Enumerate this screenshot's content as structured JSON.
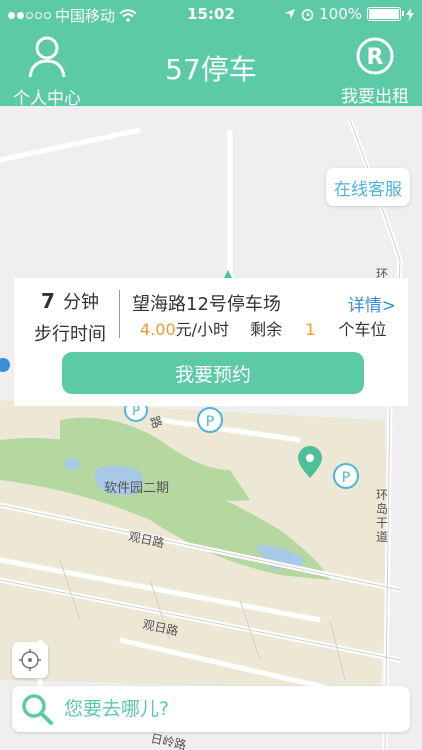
{
  "status_bar": {
    "carrier": "中国移动",
    "time": "15:02",
    "battery": "100%"
  },
  "header": {
    "title": "57停车",
    "left_label": "个人中心",
    "right_label": "我要出租"
  },
  "map": {
    "online_service": "在线客服",
    "labels": {
      "park": "软件园二期",
      "road1": "观日路",
      "road2": "观日路",
      "road3": "环岛干道",
      "road4": "路",
      "road5": "环",
      "road6": "日岭路"
    }
  },
  "card": {
    "walk_minutes": "7",
    "walk_unit": "分钟",
    "walk_label": "步行时间",
    "lot_name": "望海路12号停车场",
    "detail": "详情>",
    "price": "4.00",
    "price_unit": "元/小时",
    "spare_label": "剩余",
    "spare_count": "1",
    "spare_unit": "个车位",
    "book_label": "我要预约"
  },
  "search": {
    "placeholder": "您要去哪儿?"
  },
  "colors": {
    "brand": "#5ccaa6",
    "link": "#3a8ed8",
    "price": "#f29b27",
    "park_green": "#b5d7a0"
  }
}
